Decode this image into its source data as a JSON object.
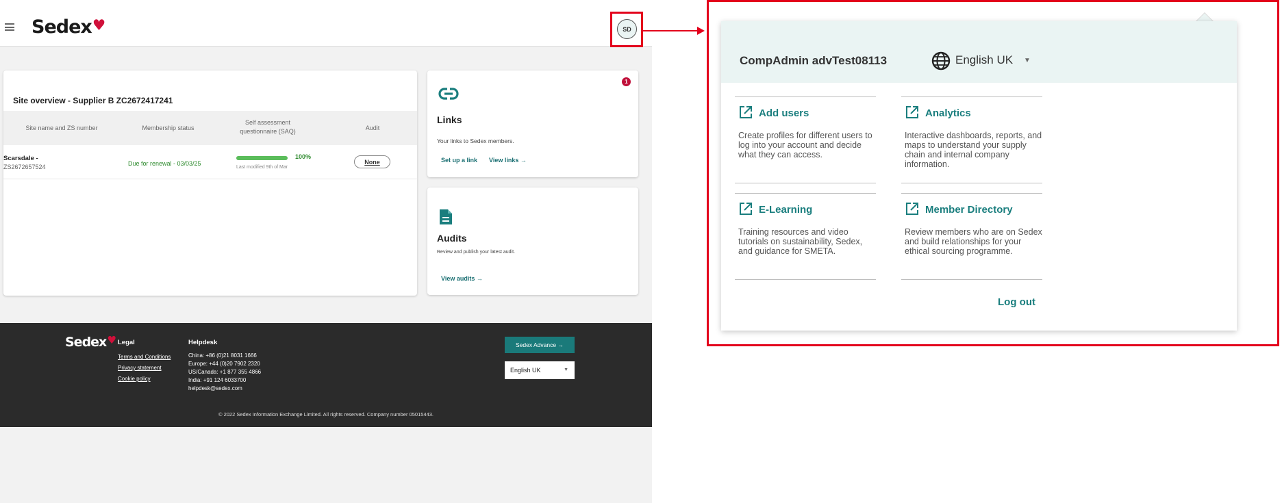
{
  "app": {
    "brand": "Sedex",
    "avatar_initials": "SD"
  },
  "site_overview": {
    "title": "Site overview - Supplier B ZC2672417241",
    "columns": [
      "Site name and ZS number",
      "Membership status",
      "Self assessment questionnaire (SAQ)",
      "Audit"
    ],
    "rows": [
      {
        "site_name": "Scarsdale -",
        "zs_number": "ZS2672657524",
        "membership": "Due for renewal - 03/03/25",
        "saq_progress": 100,
        "saq_percent": "100%",
        "saq_modified": "Last modified 9th of Mar",
        "audit": "None"
      }
    ]
  },
  "links_card": {
    "icon": "link-icon",
    "title": "Links",
    "subtitle": "Your links to Sedex members.",
    "setup_link": "Set up a link",
    "view_links": "View links",
    "notification_count": "1"
  },
  "audits_card": {
    "icon": "document-icon",
    "title": "Audits",
    "subtitle": "Review and publish your latest audit.",
    "view_audits": "View audits"
  },
  "footer": {
    "brand": "Sedex",
    "legal_heading": "Legal",
    "legal_links": [
      "Terms and Conditions",
      "Privacy statement",
      "Cookie policy"
    ],
    "helpdesk_heading": "Helpdesk",
    "helpdesk_lines": [
      "China: +86 (0)21 8031 1666",
      "Europe: +44 (0)20 7902 2320",
      "US/Canada: +1 877 355 4866",
      "India: +91 124 6033700",
      "helpdesk@sedex.com"
    ],
    "advance_button": "Sedex Advance",
    "language": "English UK",
    "copyright": "© 2022 Sedex Information Exchange Limited. All rights reserved. Company number 05015443."
  },
  "user_menu": {
    "user_name": "CompAdmin advTest08113",
    "language": "English UK",
    "items": [
      {
        "title": "Add users",
        "desc": "Create profiles for different users to log into your account and decide what they can access."
      },
      {
        "title": "Analytics",
        "desc": "Interactive dashboards, reports, and maps to understand your supply chain and internal company information."
      },
      {
        "title": "E-Learning",
        "desc": "Training resources and video tutorials on sustainability, Sedex, and guidance for SMETA."
      },
      {
        "title": "Member Directory",
        "desc": "Review members who are on Sedex and build relationships for your ethical sourcing programme."
      }
    ],
    "logout": "Log out"
  },
  "colors": {
    "brand_red": "#d0103a",
    "teal": "#1a7e7e",
    "highlight_red": "#e3001b",
    "success_green": "#2e8b2e"
  }
}
